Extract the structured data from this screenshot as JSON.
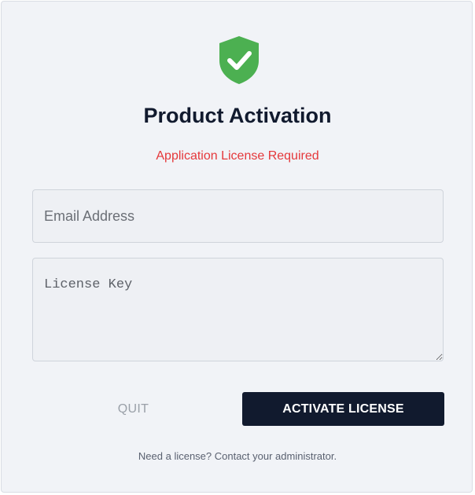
{
  "header": {
    "icon": "shield-check-icon",
    "title": "Product Activation",
    "status_message": "Application License Required"
  },
  "form": {
    "email": {
      "value": "",
      "placeholder": "Email Address"
    },
    "license_key": {
      "value": "",
      "placeholder": "License Key"
    }
  },
  "actions": {
    "quit_label": "QUIT",
    "activate_label": "ACTIVATE LICENSE"
  },
  "footer": {
    "help_text": "Need a license? Contact your administrator."
  },
  "colors": {
    "shield": "#4cb051",
    "error": "#e5383b",
    "primary": "#111a2e",
    "background": "#f1f3f7"
  }
}
